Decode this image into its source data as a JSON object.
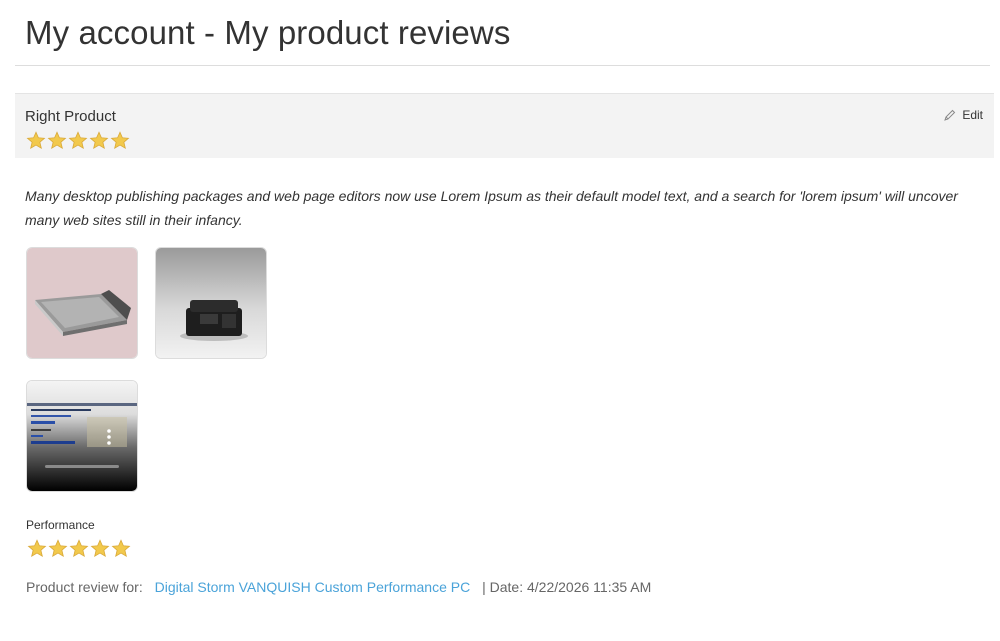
{
  "page": {
    "title": "My account - My product reviews"
  },
  "review": {
    "title": "Right Product",
    "rating": 5,
    "rating_max": 5,
    "edit_label": "Edit",
    "edit_icon": "pencil-icon",
    "text": "Many desktop publishing packages and web page editors now use Lorem Ipsum as their default model text, and a search for 'lorem ipsum' will uncover many web sites still in their infancy.",
    "images": [
      {
        "name": "laptop-image"
      },
      {
        "name": "camera-bag-image"
      },
      {
        "name": "video-thumbnail-image"
      }
    ],
    "attribute": {
      "label": "Performance",
      "rating": 5,
      "rating_max": 5
    },
    "footer": {
      "product_prefix": "Product review for:",
      "product_name": "Digital Storm VANQUISH Custom Performance PC",
      "date_text": "| Date: 4/22/2026 11:35 AM"
    }
  },
  "colors": {
    "star": "#f2c94c",
    "link": "#4aa3d9",
    "header_bg": "#f3f3f3"
  }
}
